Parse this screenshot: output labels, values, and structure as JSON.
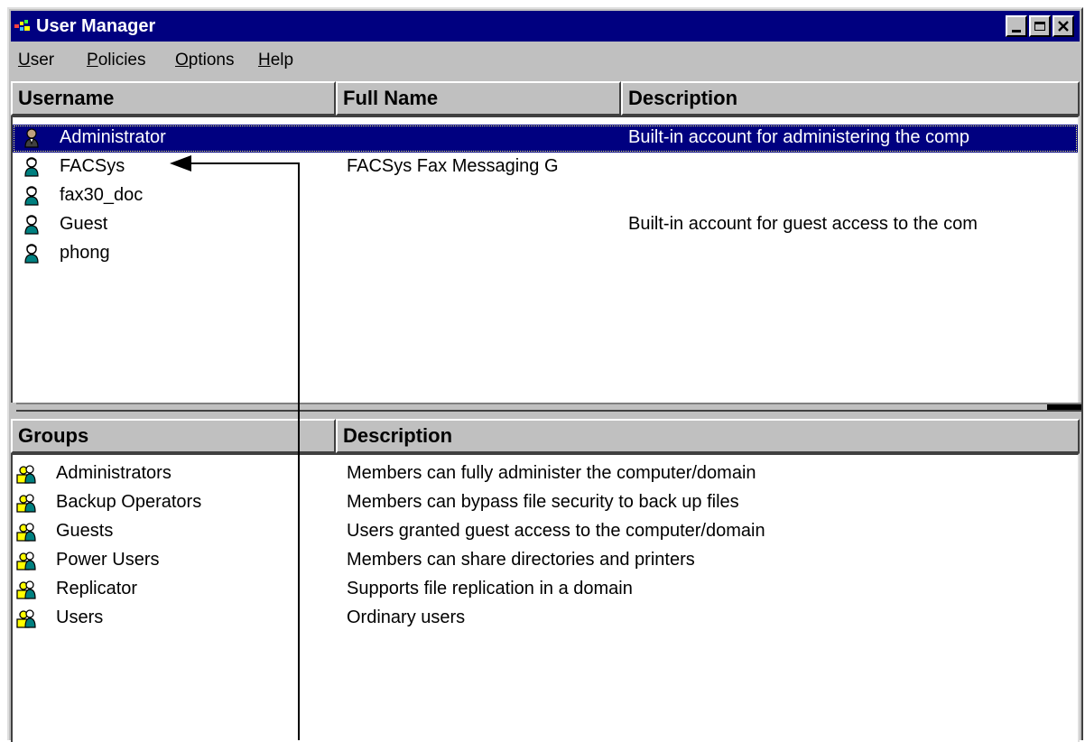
{
  "window": {
    "title": "User Manager",
    "controls": {
      "minimize": "minimize",
      "maximize": "maximize",
      "close": "close"
    }
  },
  "menu": [
    {
      "mnemonic": "U",
      "rest": "ser"
    },
    {
      "mnemonic": "P",
      "rest": "olicies"
    },
    {
      "mnemonic": "O",
      "rest": "ptions"
    },
    {
      "mnemonic": "H",
      "rest": "elp"
    }
  ],
  "users_table": {
    "columns": [
      "Username",
      "Full Name",
      "Description"
    ],
    "rows": [
      {
        "username": "Administrator",
        "full_name": "",
        "description": "Built-in account for administering the comp",
        "selected": true,
        "icon": "admin-user-icon"
      },
      {
        "username": "FACSys",
        "full_name": "FACSys Fax Messaging G",
        "description": "",
        "selected": false,
        "icon": "user-icon"
      },
      {
        "username": "fax30_doc",
        "full_name": "",
        "description": "",
        "selected": false,
        "icon": "user-icon"
      },
      {
        "username": "Guest",
        "full_name": "",
        "description": "Built-in account for guest access to the com",
        "selected": false,
        "icon": "user-icon"
      },
      {
        "username": "phong",
        "full_name": "",
        "description": "",
        "selected": false,
        "icon": "user-icon"
      }
    ]
  },
  "groups_table": {
    "columns": [
      "Groups",
      "Description"
    ],
    "rows": [
      {
        "group": "Administrators",
        "description": "Members can fully administer the computer/domain",
        "icon": "group-icon"
      },
      {
        "group": "Backup Operators",
        "description": "Members can bypass file security to back up files",
        "icon": "group-icon"
      },
      {
        "group": "Guests",
        "description": "Users granted guest access to the computer/domain",
        "icon": "group-icon"
      },
      {
        "group": "Power Users",
        "description": "Members can share directories and printers",
        "icon": "group-icon"
      },
      {
        "group": "Replicator",
        "description": "Supports file replication in a domain",
        "icon": "group-icon"
      },
      {
        "group": "Users",
        "description": "Ordinary users",
        "icon": "group-icon"
      }
    ]
  },
  "colors": {
    "title_bar": "#000080",
    "face": "#c0c0c0",
    "selection": "#000080"
  }
}
